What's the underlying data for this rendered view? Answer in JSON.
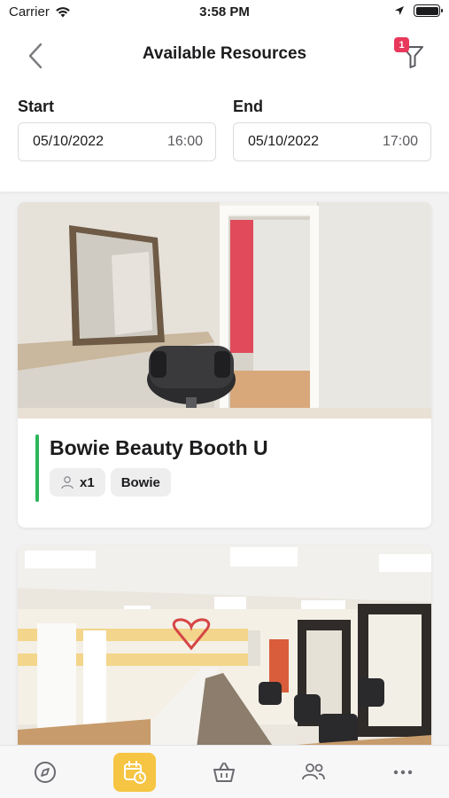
{
  "status_bar": {
    "carrier": "Carrier",
    "time": "3:58 PM"
  },
  "header": {
    "title": "Available Resources",
    "filter_count": "1"
  },
  "dates": {
    "start": {
      "label": "Start",
      "date": "05/10/2022",
      "time": "16:00"
    },
    "end": {
      "label": "End",
      "date": "05/10/2022",
      "time": "17:00"
    }
  },
  "resources": [
    {
      "title": "Bowie Beauty Booth U",
      "capacity": "x1",
      "location": "Bowie"
    }
  ],
  "tabs": [
    {
      "name": "explore",
      "icon": "compass-icon"
    },
    {
      "name": "bookings",
      "icon": "calendar-clock-icon",
      "active": true
    },
    {
      "name": "shop",
      "icon": "basket-icon"
    },
    {
      "name": "people",
      "icon": "people-icon"
    },
    {
      "name": "more",
      "icon": "more-icon"
    }
  ],
  "colors": {
    "accent_green": "#2cb75b",
    "active_tab": "#f5c543",
    "badge": "#e8395c"
  }
}
